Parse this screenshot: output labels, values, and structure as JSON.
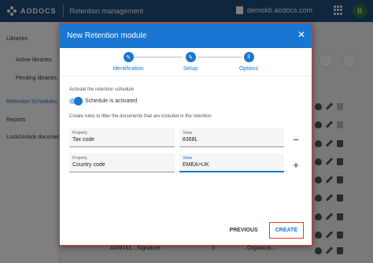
{
  "topbar": {
    "brand": "AODOCS",
    "app_title": "Retention management",
    "domain": "demokb.aodocs.com",
    "avatar_initial": "B"
  },
  "sidebar": {
    "items": [
      {
        "label": "Libraries"
      },
      {
        "label": "Active libraries"
      },
      {
        "label": "Pending libraries"
      },
      {
        "label": "Retention Schedules"
      },
      {
        "label": "Reports"
      },
      {
        "label": "Lock/Unlock documents"
      }
    ]
  },
  "background": {
    "bottom_row": [
      "ADM161...",
      "Signature",
      "3",
      "Organizat..."
    ]
  },
  "dialog": {
    "title": "New Retention module",
    "close_label": "✕",
    "steps": [
      {
        "number": "✎",
        "label": "Identification"
      },
      {
        "number": "✎",
        "label": "Setup"
      },
      {
        "number": "3",
        "label": "Options"
      }
    ],
    "activate_hint": "Activate the retention schedule",
    "toggle_label": "Schedule is activated",
    "rules_hint": "Create rules to filter the documents that are included in the retention",
    "rules": [
      {
        "property_label": "Property",
        "property_value": "Tax code",
        "value_label": "Value",
        "value_value": "8368L",
        "action": "−"
      },
      {
        "property_label": "Property",
        "property_value": "Country code",
        "value_label": "Value",
        "value_value": "EMEA>UK",
        "action": "+"
      }
    ],
    "previous_label": "PREVIOUS",
    "create_label": "CREATE"
  },
  "colors": {
    "header": "#1f4e79",
    "accent": "#1976d2",
    "highlight": "#e53935"
  }
}
